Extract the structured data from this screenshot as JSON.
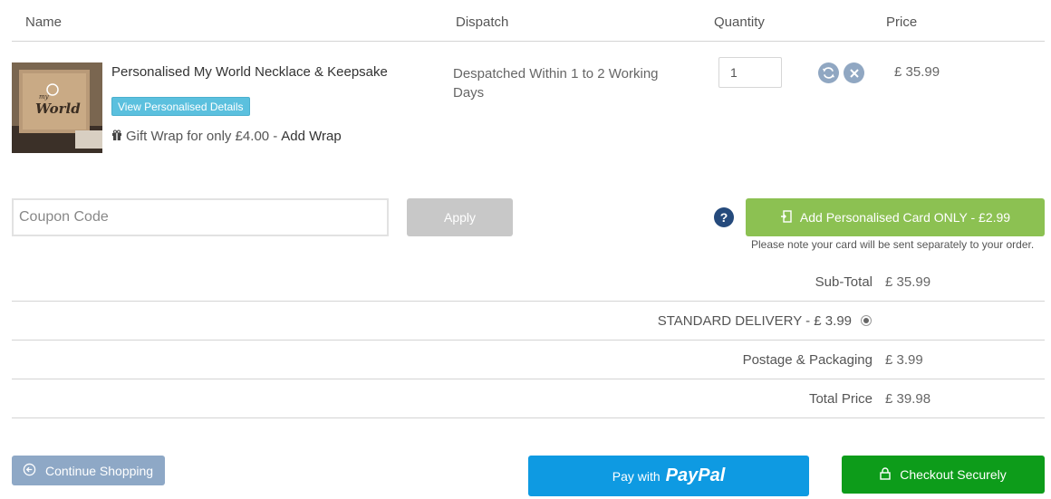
{
  "columns": {
    "name": "Name",
    "dispatch": "Dispatch",
    "quantity": "Quantity",
    "price": "Price"
  },
  "product": {
    "name": "Personalised My World Necklace & Keepsake",
    "view_details": "View Personalised Details",
    "gift_wrap_text": "Gift Wrap for only £4.00 -",
    "add_wrap": "Add Wrap",
    "dispatch": "Despatched Within 1 to 2 Working Days",
    "quantity": "1",
    "price": "£ 35.99",
    "thumb_text": "World",
    "thumb_text_small": "my"
  },
  "coupon": {
    "placeholder": "Coupon Code",
    "apply": "Apply"
  },
  "card": {
    "help": "?",
    "button": "Add Personalised Card ONLY - £2.99",
    "note": "Please note your card will be sent separately to your order."
  },
  "totals": {
    "subtotal_label": "Sub-Total",
    "subtotal_value": "£ 35.99",
    "delivery_label": "STANDARD DELIVERY - £ 3.99",
    "postage_label": "Postage & Packaging",
    "postage_value": "£ 3.99",
    "total_label": "Total Price",
    "total_value": "£ 39.98"
  },
  "actions": {
    "continue": "Continue Shopping",
    "paypal_prefix": "Pay with",
    "paypal_brand": "PayPal",
    "checkout": "Checkout Securely"
  },
  "colors": {
    "info": "#5bc0de",
    "card_green": "#8cc152",
    "checkout_green": "#0d9c1a",
    "paypal_blue": "#0e9ae2",
    "continue_blue": "#8ea8c6",
    "help_navy": "#254a7c"
  },
  "icons": {
    "gift": "gift-icon",
    "refresh": "refresh-icon",
    "remove": "remove-icon",
    "card": "card-icon",
    "back": "arrow-left-circle-icon",
    "lock": "lock-icon"
  }
}
